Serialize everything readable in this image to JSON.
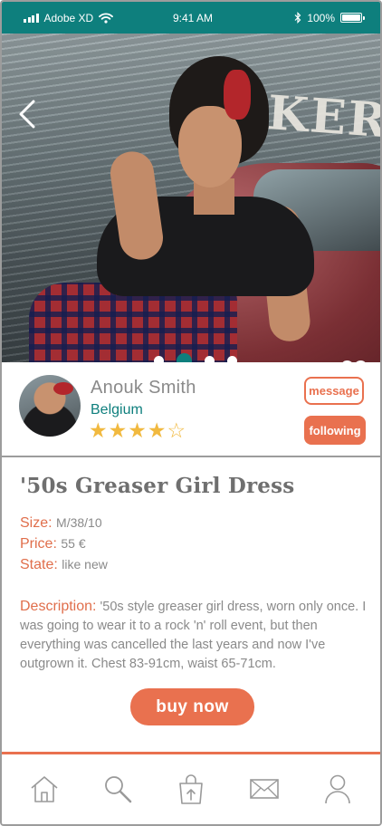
{
  "status_bar": {
    "carrier": "Adobe XD",
    "time": "9:41 AM",
    "battery_percent": "100%",
    "battery_level": 1.0
  },
  "hero": {
    "sign_text": "NKER",
    "carousel_total": 4,
    "carousel_active_index": 1
  },
  "seller": {
    "name": "Anouk Smith",
    "country": "Belgium",
    "rating": 4,
    "rating_max": 5,
    "message_label": "message",
    "following_label": "following"
  },
  "product": {
    "title": "'50s Greaser Girl Dress",
    "size_label": "Size:",
    "size_value": "M/38/10",
    "price_label": "Price:",
    "price_value": "55 €",
    "state_label": "State:",
    "state_value": "like new",
    "description_label": "Description:",
    "description_value": "'50s style greaser girl dress, worn only once. I was going to wear it to a rock 'n' roll event, but then everything was cancelled the last years and now I've outgrown it. Chest 83-91cm, waist 65-71cm.",
    "buy_label": "buy now"
  },
  "colors": {
    "teal": "#0e7f7d",
    "accent": "#e9714f",
    "star": "#f1b93f"
  },
  "icons": {
    "back": "chevron-left-icon",
    "favorite": "heart-icon",
    "tabs": [
      "home-icon",
      "search-icon",
      "shopping-bag-icon",
      "mail-icon",
      "user-icon"
    ]
  }
}
